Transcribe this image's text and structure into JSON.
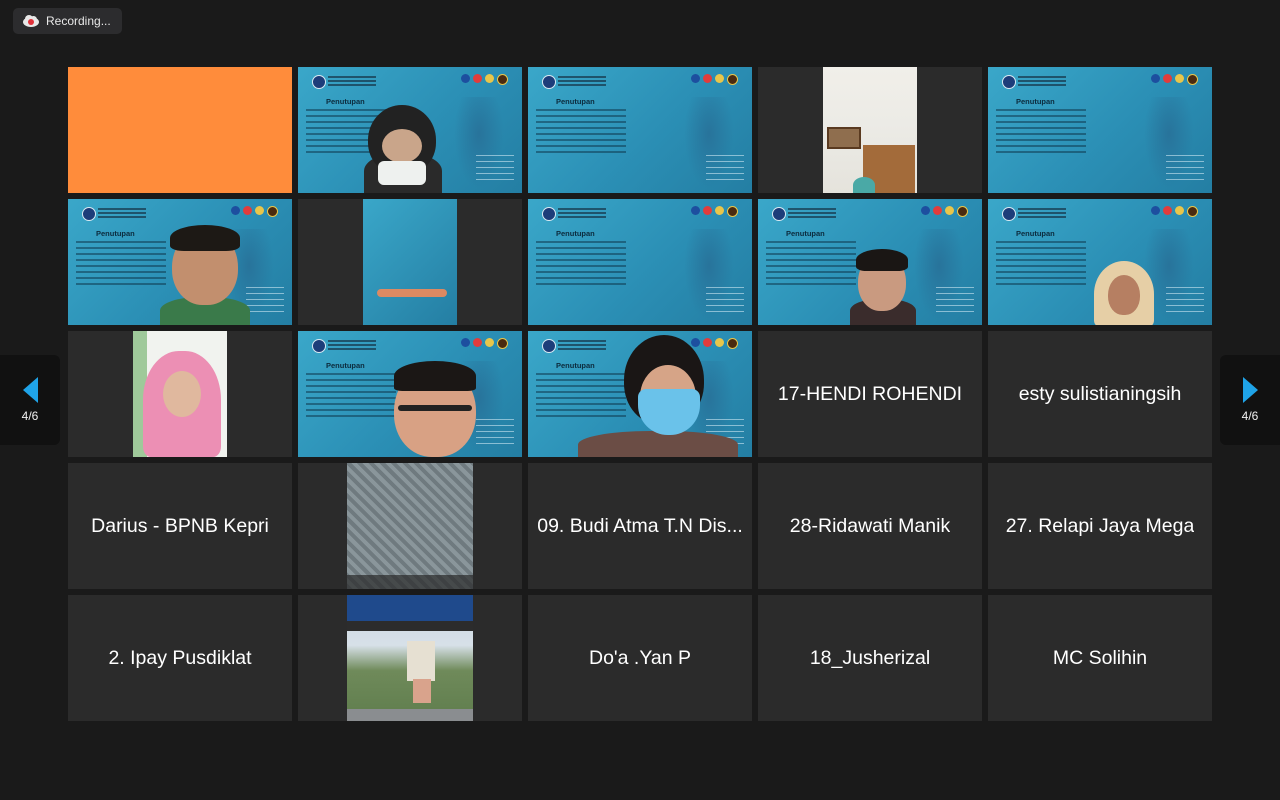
{
  "recording": {
    "label": "Recording..."
  },
  "pagination": {
    "prev_label": "4/6",
    "next_label": "4/6"
  },
  "colors": {
    "accent": "#1fa3e8",
    "tile_bg": "#2b2b2b",
    "blank_tile": "#ff8c3b",
    "slide_bg": "#2b8fb5"
  },
  "slide": {
    "title": "Penutupan"
  },
  "name_tiles": {
    "r2c3": "17-HENDI ROHENDI",
    "r2c4": "esty sulistianingsih",
    "r3c0": "Darius - BPNB Kepri",
    "r3c2": "09. Budi Atma T.N Dis...",
    "r3c3": "28-Ridawati Manik",
    "r3c4": "27. Relapi Jaya Mega",
    "r4c0": "2. Ipay Pusdiklat",
    "r4c2": "Do'a .Yan P",
    "r4c3": "18_Jusherizal",
    "r4c4": "MC Solihin"
  }
}
